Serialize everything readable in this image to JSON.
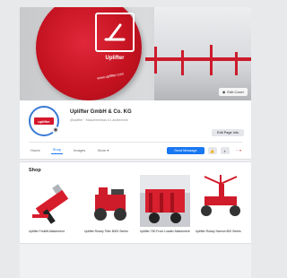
{
  "cover": {
    "drum_brand": "Uplifter",
    "drum_url": "www.uplifter.com",
    "camera_button_label": "Edit Cover",
    "colors": {
      "brand_red": "#cc1b2b"
    }
  },
  "page": {
    "name": "Uplifter GmbH & Co. KG",
    "subtitle": "@uplifter · Maschinenbau & Landtechnik",
    "avatar_logo_text": "uplifter",
    "edit_button_label": "Edit Page Info"
  },
  "tabs": [
    {
      "label": "Home"
    },
    {
      "label": "Shop"
    },
    {
      "label": "Images"
    },
    {
      "label": "More ▾"
    }
  ],
  "actions": {
    "primary_label": "Send Message",
    "like_icon": "thumbs-up-icon",
    "search_icon": "search-icon",
    "more_label": "··· ▾"
  },
  "shop": {
    "title": "Shop",
    "products": [
      {
        "name": "Uplifter Forklift Attachment",
        "icon": "forklift-attachment-image"
      },
      {
        "name": "Uplifter Rotary Tiller 8000 Series",
        "icon": "red-machine-image"
      },
      {
        "name": "Uplifter 750 Front Loader Attachment",
        "icon": "loader-machine-image"
      },
      {
        "name": "Uplifter Rotary Harrow 800 Series",
        "icon": "harrow-machine-image"
      }
    ]
  }
}
